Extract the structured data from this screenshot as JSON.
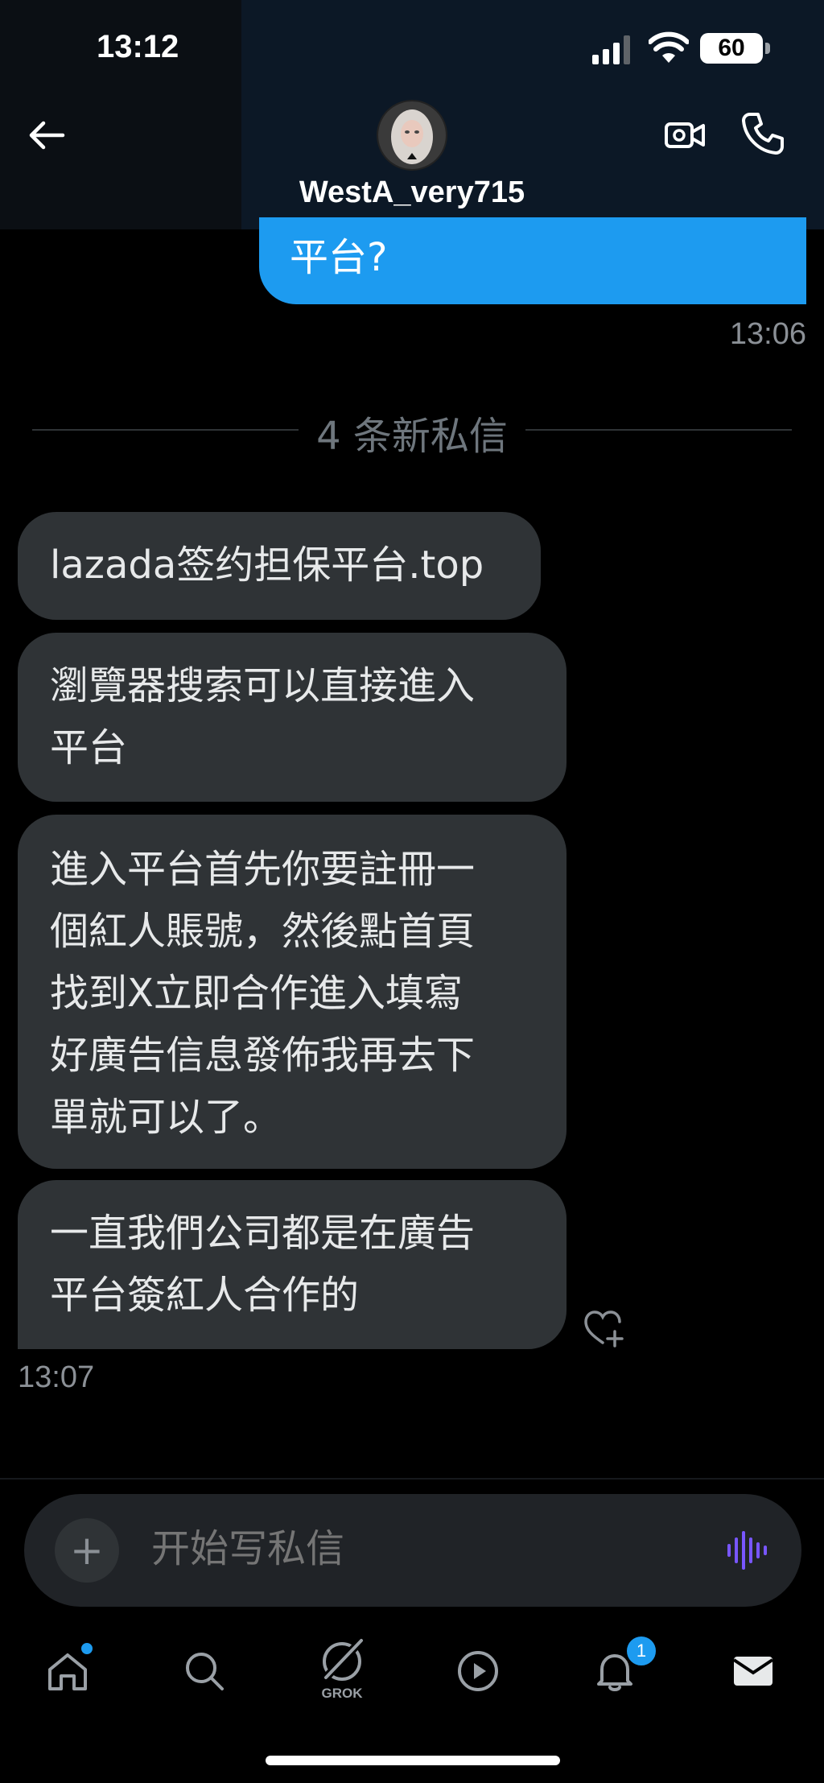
{
  "status_bar": {
    "time": "13:12",
    "battery": "60"
  },
  "header": {
    "username": "WestA_very715"
  },
  "sent_message": {
    "text": "平台?",
    "time": "13:06"
  },
  "divider": {
    "label": "4 条新私信"
  },
  "received_messages": [
    {
      "lines": [
        "lazada签约担保平台.top"
      ]
    },
    {
      "lines": [
        "瀏覽器搜索可以直接進入",
        "平台"
      ]
    },
    {
      "lines": [
        "進入平台首先你要註冊一",
        "個紅人賬號，然後點首頁",
        "找到X立即合作進入填寫",
        "好廣告信息發佈我再去下",
        "單就可以了。"
      ]
    },
    {
      "lines": [
        "一直我們公司都是在廣告",
        "平台簽紅人合作的"
      ]
    }
  ],
  "received_time": "13:07",
  "composer": {
    "placeholder": "开始写私信"
  },
  "tabbar": {
    "grok_label": "GROK",
    "notifications_count": "1"
  },
  "colors": {
    "accent": "#1d9bf0",
    "bubble": "#2f3336",
    "background": "#000000",
    "voice_icon": "#7856ff"
  },
  "icons": [
    "back-arrow-icon",
    "video-camera-icon",
    "phone-icon",
    "heart-plus-icon",
    "plus-icon",
    "voice-wave-icon",
    "home-icon",
    "search-icon",
    "grok-icon",
    "play-icon",
    "bell-icon",
    "mail-icon"
  ]
}
